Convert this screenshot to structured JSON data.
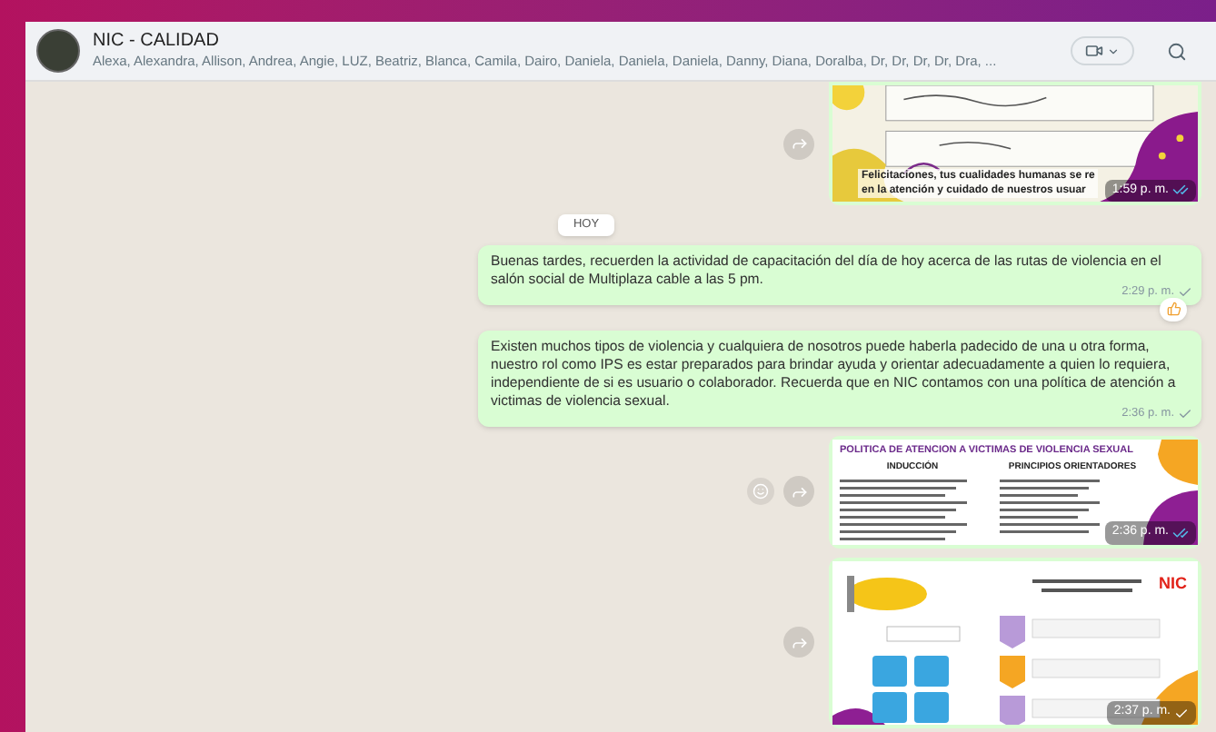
{
  "chat": {
    "title": "NIC - CALIDAD",
    "members": "Alexa, Alexandra, Allison, Andrea, Angie, LUZ, Beatriz, Blanca, Camila, Dairo, Daniela, Daniela, Daniela, Danny, Diana, Doralba, Dr, Dr, Dr, Dr, Dra, ..."
  },
  "messages": [
    {
      "caption": [
        "Felicitaciones, tus cualidades humanas se re",
        "en la atención y cuidado de nuestros usuar"
      ],
      "time": "1:59 p. m.",
      "read": true,
      "reacted": false
    },
    {
      "kind": "date",
      "label": "HOY"
    },
    {
      "kind": "text",
      "text": "Buenas tardes, recuerden la actividad de capacitación del día de hoy acerca de las rutas de violencia en el salón social de Multiplaza cable a las 5 pm.",
      "time": "2:29 p. m.",
      "read": false,
      "reacted": true
    },
    {
      "kind": "text",
      "text": "Existen muchos tipos de violencia y cualquiera de nosotros puede haberla padecido de una u otra forma, nuestro rol como IPS es estar preparados para brindar ayuda y orientar adecuadamente a quien lo requiera, independiente de si es usuario o colaborador. Recuerda que en NIC contamos con una política de atención a victimas de violencia sexual.",
      "time": "2:36 p. m.",
      "read": false,
      "reacted": false
    },
    {
      "kind": "policy_slide",
      "title": "POLITICA DE ATENCION A VICTIMAS DE VIOLENCIA SEXUAL",
      "columns": [
        "INDUCCIÓN",
        "PRINCIPIOS ORIENTADORES"
      ],
      "time": "2:36 p. m.",
      "read": true,
      "reacted": false
    },
    {
      "kind": "roles_slide",
      "logo": "NIC",
      "time": "2:37 p. m.",
      "read": false,
      "reacted": false
    }
  ]
}
